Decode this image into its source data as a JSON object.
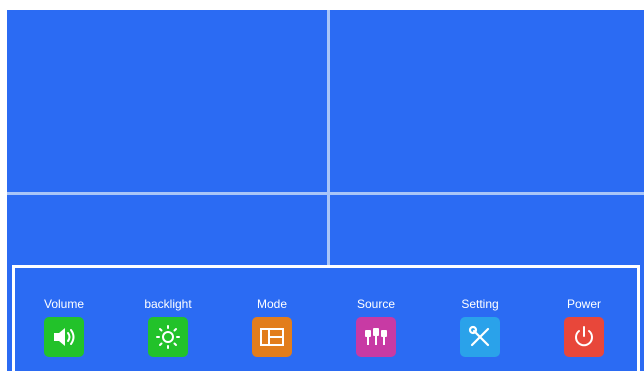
{
  "menu": {
    "items": [
      {
        "label": "Volume",
        "icon": "speaker-icon",
        "color": "#22c22a"
      },
      {
        "label": "backlight",
        "icon": "sun-icon",
        "color": "#22c22a"
      },
      {
        "label": "Mode",
        "icon": "layout-icon",
        "color": "#e27d1c"
      },
      {
        "label": "Source",
        "icon": "connectors-icon",
        "color": "#c83aa4"
      },
      {
        "label": "Setting",
        "icon": "tools-icon",
        "color": "#2aa2ea"
      },
      {
        "label": "Power",
        "icon": "power-icon",
        "color": "#e8473a"
      }
    ]
  },
  "colors": {
    "background": "#2b6bf3",
    "divider": "#a9c5f8",
    "panel_border": "#ffffff"
  }
}
